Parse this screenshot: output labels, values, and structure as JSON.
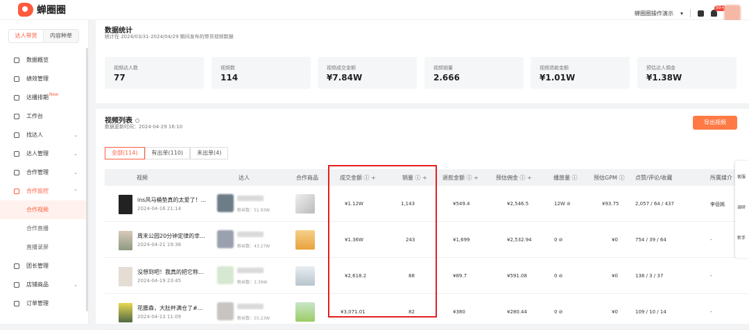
{
  "app": {
    "name": "蝉圈圈"
  },
  "topbar": {
    "demo_label": "蝉圈圈操作演示",
    "notif_count": "99+"
  },
  "sidebar": {
    "tabs": [
      "达人带货",
      "内容种草"
    ],
    "items": [
      {
        "label": "数据概览",
        "chev": ""
      },
      {
        "label": "绩效管理",
        "chev": ""
      },
      {
        "label": "达播排期",
        "chev": "",
        "badge": "New"
      },
      {
        "label": "工作台",
        "chev": ""
      },
      {
        "label": "找达人",
        "chev": "⌄"
      },
      {
        "label": "达人管理",
        "chev": "⌄"
      },
      {
        "label": "合作管理",
        "chev": "⌄"
      },
      {
        "label": "合作监控",
        "chev": "⌃"
      },
      {
        "label": "合作视频",
        "chev": ""
      },
      {
        "label": "合作直播",
        "chev": ""
      },
      {
        "label": "直播录屏",
        "chev": ""
      },
      {
        "label": "团长管理",
        "chev": ""
      },
      {
        "label": "店铺商品",
        "chev": "⌄"
      },
      {
        "label": "订单管理",
        "chev": ""
      }
    ]
  },
  "stats_header": {
    "title": "数据统计",
    "subtitle": "统计在 2024/03/31-2024/04/29 期间发布的带货视频数据"
  },
  "stats": [
    {
      "label": "视频达人数",
      "value": "77"
    },
    {
      "label": "视频数",
      "value": "114"
    },
    {
      "label": "视频成交金额",
      "value": "¥7.84W"
    },
    {
      "label": "视频销量",
      "value": "2.666"
    },
    {
      "label": "视频退款金额",
      "value": "¥1.01W"
    },
    {
      "label": "预估达人佣金",
      "value": "¥1.38W"
    }
  ],
  "video_list": {
    "title": "视频列表",
    "updated": "数据更新时间：2024-04-29 16:10",
    "export_label": "导出视频",
    "filters": [
      "全部(114)",
      "有出单(110)",
      "未出单(4)"
    ],
    "headers": [
      "视频",
      "达人",
      "合作商品",
      "成交金额 ⓘ ÷",
      "销量 ⓘ ÷",
      "退款金额 ⓘ ÷",
      "预估佣金 ⓘ ÷",
      "播放量 ⓘ",
      "预估GPM ⓘ",
      "点赞/评论/收藏",
      "所属媒介"
    ],
    "rows": [
      {
        "title": "ins风马桶垫真的太爱了！...",
        "date": "2024-04-16 21:14",
        "fans": "粉丝数：51.93W",
        "amount": "¥1.12W",
        "sales": "1,143",
        "refund": "¥549.4",
        "commission": "¥2,546.5",
        "plays": "12W ⊘",
        "gpm": "¥93.75",
        "engagement": "2,057 / 64 / 437",
        "media": "李佰嫣"
      },
      {
        "title": "周末公园20分钟定律的幸...",
        "date": "2024-04-21 19:38",
        "fans": "粉丝数：43.27W",
        "amount": "¥1.36W",
        "sales": "243",
        "refund": "¥1,699",
        "commission": "¥2,532.94",
        "plays": "0 ⊘",
        "gpm": "¥0",
        "engagement": "754 / 39 / 64",
        "media": "-"
      },
      {
        "title": "没想到吧！我真的把它称...",
        "date": "2024-04-19 23:45",
        "fans": "粉丝数：3.39W",
        "amount": "¥2,618.2",
        "sales": "88",
        "refund": "¥89.7",
        "commission": "¥591.08",
        "plays": "0 ⊘",
        "gpm": "¥0",
        "engagement": "138 / 3 / 37",
        "media": "-"
      },
      {
        "title": "花腰森，大肚杯满仓了#...",
        "date": "2024-04-13 11:09",
        "fans": "粉丝数：55.23W",
        "amount": "¥3,071.01",
        "sales": "82",
        "refund": "¥380",
        "commission": "¥280.44",
        "plays": "0 ⊘",
        "gpm": "¥0",
        "engagement": "109 / 10 / 14",
        "media": "-"
      }
    ]
  },
  "right_panel": [
    "客服",
    "调研",
    "新手"
  ]
}
